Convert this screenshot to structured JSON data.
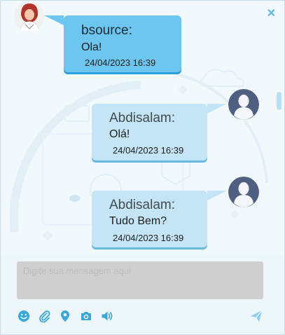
{
  "chat": {
    "messages": [
      {
        "author": "bsource:",
        "text": "Ola!",
        "timestamp": "24/04/2023 16:39"
      },
      {
        "author": "Abdisalam:",
        "text": "Olá!",
        "timestamp": "24/04/2023 16:39"
      },
      {
        "author": "Abdisalam:",
        "text": "Tudo Bem?",
        "timestamp": "24/04/2023 16:39"
      }
    ]
  },
  "composer": {
    "placeholder": "Digite sua mensagem aqui",
    "value": ""
  },
  "toolbar": {
    "icons": [
      "smiley-icon",
      "paperclip-icon",
      "location-pin-icon",
      "camera-icon",
      "speaker-icon",
      "send-icon"
    ]
  },
  "colors": {
    "agent_bubble": "#6dc6ef",
    "user_bubble": "#c4e5f5",
    "accent": "#3aa7da",
    "input_bg": "#cfcfcf"
  }
}
